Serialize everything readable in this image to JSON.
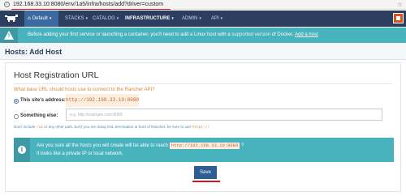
{
  "browser": {
    "url": "192.168.33.10:8080/env/1a5/infra/hosts/add?driver=custom"
  },
  "nav": {
    "environment": "Default",
    "items": [
      "STACKS",
      "CATALOG",
      "INFRASTRUCTURE",
      "ADMIN",
      "API"
    ],
    "selected": "INFRASTRUCTURE"
  },
  "banner": {
    "text_before": "Before adding your first service or launching a container, you'll need to add a Linux host with a",
    "link": "supported version",
    "text_after": "of Docker.",
    "action": "Add a host"
  },
  "page": {
    "title": "Hosts: Add Host"
  },
  "form": {
    "section_title": "Host Registration URL",
    "question": "What base URL should hosts use to connect to the Rancher API?",
    "option_site": "This site's address:",
    "site_url": "http://192.168.33.10:8080",
    "option_custom": "Something else:",
    "custom_placeholder": "e.g. http://example.com:8080",
    "hint_1": "Don't include",
    "hint_code1": "/v1",
    "hint_2": "or any other path, but if you are doing",
    "hint_ssl": "SSL termination",
    "hint_3": "in front of Rancher, be sure to use",
    "hint_code2": "https://",
    "selected_option": "site"
  },
  "warning": {
    "line1_before": "Are you sure all the hosts you will create will be able to reach",
    "line1_url": "http://192.168.33.10:8080",
    "line1_after": "?",
    "line2": "It looks like a private IP or local network."
  },
  "actions": {
    "save_label": "Save"
  },
  "colors": {
    "navbar": "#2c3e5f",
    "banner": "#48b2bd",
    "primary_button": "#2c5e94",
    "highlight_underline": "#d9131b",
    "url_text": "#c9631f"
  }
}
